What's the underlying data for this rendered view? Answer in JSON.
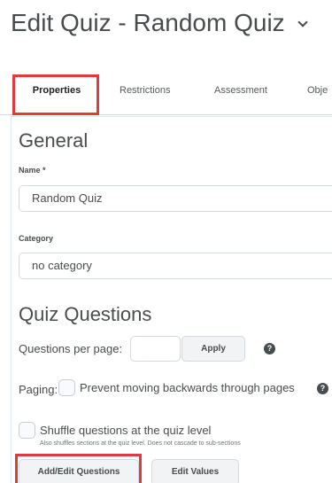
{
  "header": {
    "title": "Edit Quiz - Random Quiz",
    "menu_icon": "chevron-down-icon"
  },
  "tabs": [
    {
      "label": "Properties",
      "selected": true
    },
    {
      "label": "Restrictions",
      "selected": false
    },
    {
      "label": "Assessment",
      "selected": false
    },
    {
      "label": "Obje",
      "selected": false
    }
  ],
  "general": {
    "heading": "General",
    "name_label": "Name *",
    "name_value": "Random Quiz",
    "category_label": "Category",
    "category_value": "no category"
  },
  "quiz_questions": {
    "heading": "Quiz Questions",
    "questions_per_page_label": "Questions per page:",
    "questions_per_page_value": "",
    "apply_label": "Apply",
    "paging_label": "Paging:",
    "prevent_backwards_label": "Prevent moving backwards through pages",
    "prevent_backwards_checked": false,
    "shuffle_label": "Shuffle questions at the quiz level",
    "shuffle_checked": false,
    "shuffle_help": "Also shuffles sections at the quiz level. Does not cascade to sub-sections",
    "add_edit_label": "Add/Edit Questions",
    "edit_values_label": "Edit Values",
    "help_icon_glyph": "?"
  },
  "colors": {
    "highlight_box": "#e03a3e",
    "text": "#494c4e",
    "button_bg": "#f1f3f5",
    "border": "#d3d9e3"
  }
}
